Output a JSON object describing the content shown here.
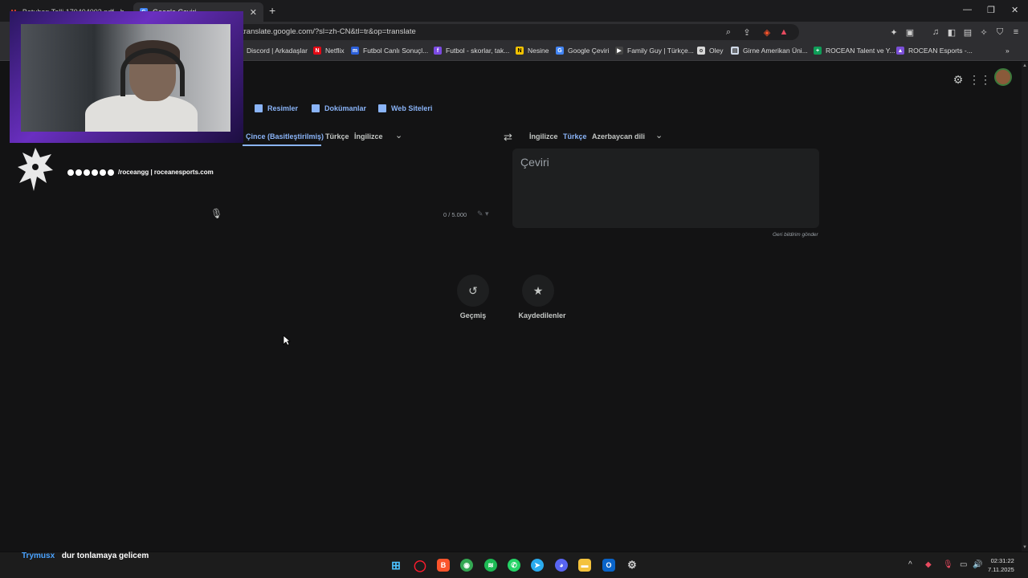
{
  "browser": {
    "tabs": [
      {
        "title": "Batuhan Telli 170404003.pdf - htbot"
      },
      {
        "title": "Google Çeviri"
      }
    ],
    "url": "translate.google.com/?sl=zh-CN&tl=tr&op=translate",
    "bookmarks": [
      {
        "label": "Discord | Arkadaşlar",
        "color": "#5865f2"
      },
      {
        "label": "Netflix",
        "color": "#e50914"
      },
      {
        "label": "Futbol Canlı Sonuçl...",
        "color": "#2b5fd9"
      },
      {
        "label": "Futbol - skorlar, tak...",
        "color": "#7b4ae2"
      },
      {
        "label": "Nesine",
        "color": "#f2c200"
      },
      {
        "label": "Google Çeviri",
        "color": "#4285f4"
      },
      {
        "label": "Family Guy | Türkçe...",
        "color": "#444444"
      },
      {
        "label": "Oley",
        "color": "#d8d8d8"
      },
      {
        "label": "Girne Amerikan Üni...",
        "color": "#cfd8e6"
      },
      {
        "label": "ROCEAN Talent ve Y...",
        "color": "#0f9d58"
      },
      {
        "label": "ROCEAN Esports -...",
        "color": "#7a4fd6"
      }
    ]
  },
  "translate": {
    "modes": [
      {
        "label": "Resimler"
      },
      {
        "label": "Dokümanlar"
      },
      {
        "label": "Web Siteleri"
      }
    ],
    "source_langs": [
      "Çince (Basitleştirilmiş)",
      "Türkçe",
      "İngilizce"
    ],
    "target_langs": [
      "İngilizce",
      "Türkçe",
      "Azerbaycan dili"
    ],
    "char_counter": "0 / 5.000",
    "output_placeholder": "Çeviri",
    "feedback_link": "Geri bildirim gönder",
    "history_label": "Geçmiş",
    "saved_label": "Kaydedilenler",
    "accent_color": "#8ab4f8"
  },
  "overlay": {
    "socials": "/roceangg | roceanesports.com",
    "chat_user": "Trymusx",
    "chat_message": "dur tonlamaya gelicem"
  },
  "taskbar": {
    "time": "02:31:22",
    "date": "7.11.2025"
  }
}
